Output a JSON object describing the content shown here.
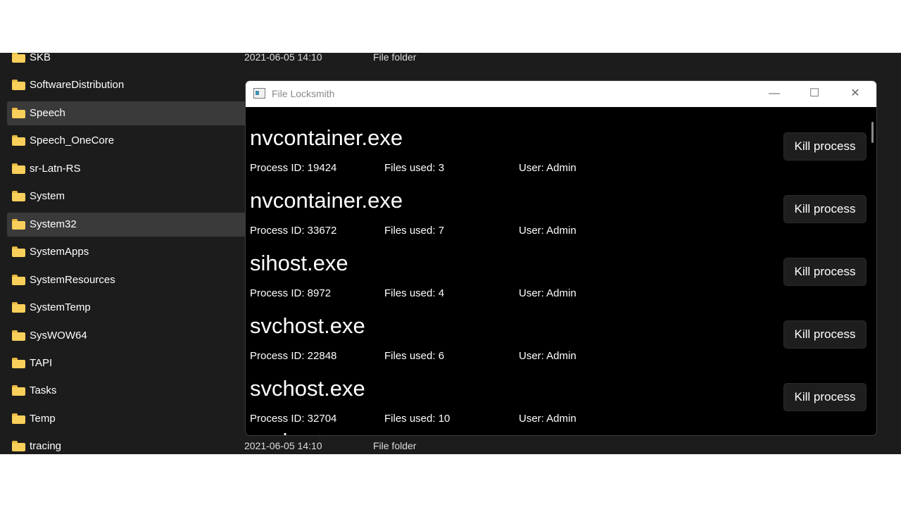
{
  "explorer": {
    "folders": [
      {
        "name": "SKB",
        "date": "2021-06-05 14:10",
        "type": "File folder",
        "selected": false
      },
      {
        "name": "SoftwareDistribution",
        "date": "",
        "type": "",
        "selected": false
      },
      {
        "name": "Speech",
        "date": "",
        "type": "",
        "selected": true
      },
      {
        "name": "Speech_OneCore",
        "date": "",
        "type": "",
        "selected": false
      },
      {
        "name": "sr-Latn-RS",
        "date": "",
        "type": "",
        "selected": false
      },
      {
        "name": "System",
        "date": "",
        "type": "",
        "selected": false
      },
      {
        "name": "System32",
        "date": "",
        "type": "",
        "selected": true
      },
      {
        "name": "SystemApps",
        "date": "",
        "type": "",
        "selected": false
      },
      {
        "name": "SystemResources",
        "date": "",
        "type": "",
        "selected": false
      },
      {
        "name": "SystemTemp",
        "date": "",
        "type": "",
        "selected": false
      },
      {
        "name": "SysWOW64",
        "date": "",
        "type": "",
        "selected": false
      },
      {
        "name": "TAPI",
        "date": "",
        "type": "",
        "selected": false
      },
      {
        "name": "Tasks",
        "date": "",
        "type": "",
        "selected": false
      },
      {
        "name": "Temp",
        "date": "",
        "type": "",
        "selected": false
      },
      {
        "name": "tracing",
        "date": "2021-06-05 14:10",
        "type": "File folder",
        "selected": false
      }
    ],
    "folder_icon": "folder-icon",
    "folder_color": "#f8cf5a"
  },
  "locksmith": {
    "title": "File Locksmith",
    "minimize_glyph": "—",
    "maximize_glyph": "☐",
    "close_glyph": "✕",
    "processes": [
      {
        "name": "nvcontainer.exe",
        "pid": "Process ID: 19424",
        "files": "Files used: 3",
        "user": "User: Admin",
        "kill_label": "Kill process"
      },
      {
        "name": "nvcontainer.exe",
        "pid": "Process ID: 33672",
        "files": "Files used: 7",
        "user": "User: Admin",
        "kill_label": "Kill process"
      },
      {
        "name": "sihost.exe",
        "pid": "Process ID: 8972",
        "files": "Files used: 4",
        "user": "User: Admin",
        "kill_label": "Kill process"
      },
      {
        "name": "svchost.exe",
        "pid": "Process ID: 22848",
        "files": "Files used: 6",
        "user": "User: Admin",
        "kill_label": "Kill process"
      },
      {
        "name": "svchost.exe",
        "pid": "Process ID: 32704",
        "files": "Files used: 10",
        "user": "User: Admin",
        "kill_label": "Kill process"
      }
    ],
    "partial_next_name": "svchost.exe"
  }
}
